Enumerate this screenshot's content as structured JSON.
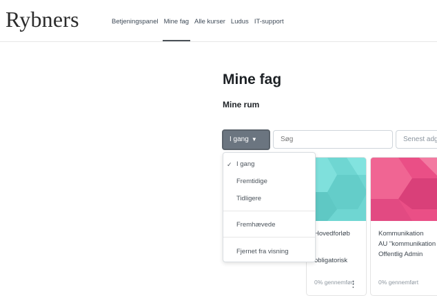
{
  "brand": {
    "logo_text": "Rybners"
  },
  "nav": {
    "items": [
      {
        "label": "Betjeningspanel"
      },
      {
        "label": "Mine fag"
      },
      {
        "label": "Alle kurser"
      },
      {
        "label": "Ludus"
      },
      {
        "label": "IT-support"
      }
    ],
    "active": "Mine fag"
  },
  "page": {
    "title": "Mine fag",
    "section_title": "Mine rum"
  },
  "filters": {
    "status_button": "I gang",
    "search_placeholder": "Søg",
    "sort_label": "Senest adgang"
  },
  "dropdown": {
    "items": [
      {
        "label": "I gang",
        "checked": true
      },
      {
        "label": "Fremtidige",
        "checked": false
      },
      {
        "label": "Tidligere",
        "checked": false
      },
      {
        "label": "Fremhævede",
        "checked": false
      },
      {
        "label": "Fjernet fra visning",
        "checked": false
      }
    ]
  },
  "courses": [
    {
      "title_line1": "Hovedforløb",
      "title_line2": "obligatorisk",
      "progress": "0% gennemført",
      "menu": "⋮",
      "color": "#6fd6d2"
    },
    {
      "title_line1": "Kommunikation",
      "title_line2": "AU \"kommunikation",
      "title_line3": "Offentlig Admin",
      "progress": "0% gennemført",
      "color": "#ea4f86"
    }
  ]
}
